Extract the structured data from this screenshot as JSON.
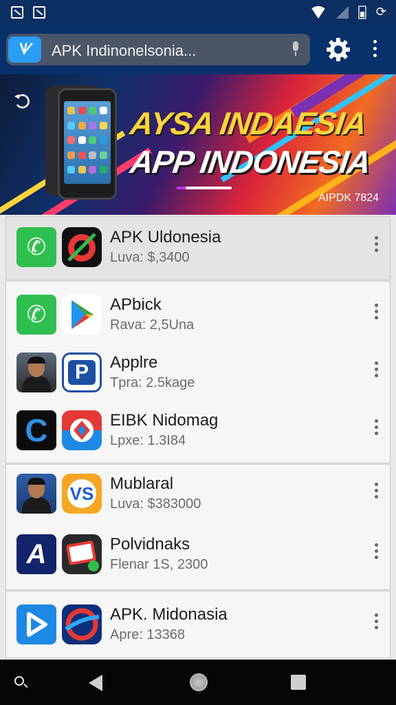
{
  "status_bar": {
    "icons": [
      "notification-icon",
      "notification-icon",
      "wifi-icon",
      "signal-icon",
      "battery-icon",
      "sync-icon"
    ]
  },
  "app_bar": {
    "search_text": "APK Indinonelsonia...",
    "icons": [
      "app-logo-icon",
      "mic-icon",
      "gear-icon",
      "more-vert-icon"
    ]
  },
  "banner": {
    "title_line1": "AYSA INDAESIA",
    "title_line2": "APP INDONESIA",
    "caption": "AIPDK 7824",
    "icons": [
      "refresh-icon",
      "phone-image"
    ]
  },
  "apps": {
    "featured": {
      "title": "APK Uldonesia",
      "subtitle": "Luva: $,3400"
    },
    "group1": [
      {
        "title": "APbick",
        "subtitle": "Rava: 2,5Una"
      },
      {
        "title": "Applre",
        "subtitle": "Tpra: 2.5kage"
      },
      {
        "title": "EIBK Nidomag",
        "subtitle": "Lpxe: 1.3I84"
      }
    ],
    "group2": [
      {
        "title": "Mublaral",
        "subtitle": "Luva: $383000"
      },
      {
        "title": "Polvidnaks",
        "subtitle": "Flenar 1S, 2300"
      }
    ],
    "group3": [
      {
        "title": "APK. Midonasia",
        "subtitle": "Apre: 13368"
      }
    ]
  },
  "icon_text": {
    "parking": "P",
    "c_logo": "C",
    "vs_logo": "VS",
    "a_logo": "A"
  },
  "colors": {
    "status_bar": "#0b2f63",
    "app_bar": "#08306a",
    "phone_green": "#2fbf4e",
    "list_bg": "#e9e9e9"
  }
}
